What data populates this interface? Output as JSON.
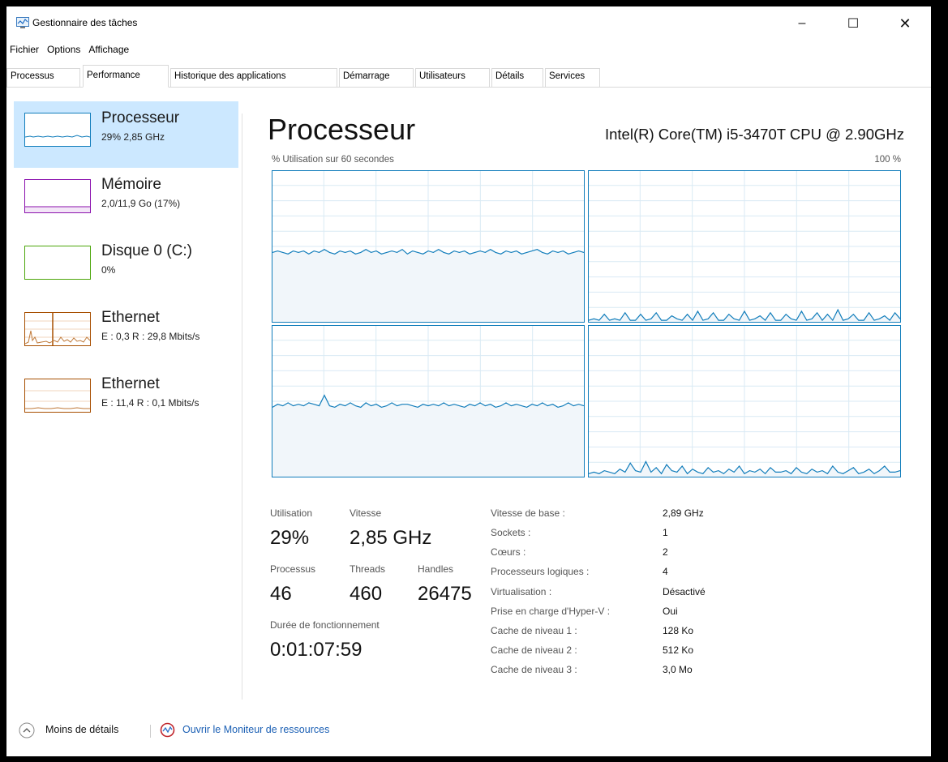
{
  "window": {
    "title": "Gestionnaire des tâches",
    "controls": {
      "minimize": "–",
      "maximize": "☐",
      "close": "✕"
    }
  },
  "menu": [
    "Fichier",
    "Options",
    "Affichage"
  ],
  "tabs": [
    "Processus",
    "Performance",
    "Historique des applications",
    "Démarrage",
    "Utilisateurs",
    "Détails",
    "Services"
  ],
  "active_tab": "Performance",
  "sidebar": {
    "items": [
      {
        "name": "Processeur",
        "sub": "29% 2,85 GHz",
        "color": "#117dbb",
        "selected": true
      },
      {
        "name": "Mémoire",
        "sub": "2,0/11,9 Go (17%)",
        "color": "#8b12ae",
        "selected": false
      },
      {
        "name": "Disque 0 (C:)",
        "sub": "0%",
        "color": "#4da60c",
        "selected": false
      },
      {
        "name": "Ethernet",
        "sub": "E : 0,3 R : 29,8 Mbits/s",
        "color": "#a74f01",
        "selected": false
      },
      {
        "name": "Ethernet",
        "sub": "E : 11,4 R : 0,1 Mbits/s",
        "color": "#a74f01",
        "selected": false
      }
    ]
  },
  "main": {
    "title": "Processeur",
    "cpu_model": "Intel(R) Core(TM) i5-3470T CPU @ 2.90GHz",
    "graph_caption": "% Utilisation sur 60 secondes",
    "graph_max": "100 %",
    "graph_color": "#117dbb",
    "graph_fill": "#f1f6fa",
    "grid_color": "#d9eaf4"
  },
  "stats": {
    "utilisation_label": "Utilisation",
    "utilisation": "29%",
    "vitesse_label": "Vitesse",
    "vitesse": "2,85 GHz",
    "processus_label": "Processus",
    "processus": "46",
    "threads_label": "Threads",
    "threads": "460",
    "handles_label": "Handles",
    "handles": "26475",
    "uptime_label": "Durée de fonctionnement",
    "uptime": "0:01:07:59"
  },
  "specs": [
    {
      "label": "Vitesse de base :",
      "value": "2,89 GHz"
    },
    {
      "label": "Sockets :",
      "value": "1"
    },
    {
      "label": "Cœurs :",
      "value": "2"
    },
    {
      "label": "Processeurs logiques :",
      "value": "4"
    },
    {
      "label": "Virtualisation :",
      "value": "Désactivé"
    },
    {
      "label": "Prise en charge d'Hyper-V :",
      "value": "Oui"
    },
    {
      "label": "Cache de niveau 1 :",
      "value": "128 Ko"
    },
    {
      "label": "Cache de niveau 2 :",
      "value": "512 Ko"
    },
    {
      "label": "Cache de niveau 3 :",
      "value": "3,0 Mo"
    }
  ],
  "footer": {
    "less_details": "Moins de détails",
    "resource_monitor": "Ouvrir le Moniteur de ressources"
  },
  "chart_data": [
    {
      "type": "area",
      "name": "core-0",
      "ylim": [
        0,
        100
      ],
      "values": [
        46,
        47,
        46,
        45,
        47,
        46,
        47,
        45,
        47,
        46,
        48,
        46,
        45,
        47,
        46,
        47,
        45,
        46,
        48,
        46,
        47,
        45,
        46,
        47,
        46,
        48,
        45,
        47,
        46,
        45,
        47,
        46,
        48,
        46,
        45,
        47,
        46,
        47,
        45,
        46,
        47,
        46,
        48,
        46,
        45,
        47,
        46,
        47,
        45,
        46,
        47,
        48,
        46,
        45,
        47,
        46,
        47,
        45,
        46,
        47,
        46
      ]
    },
    {
      "type": "area",
      "name": "core-1",
      "ylim": [
        0,
        100
      ],
      "values": [
        1,
        2,
        1,
        5,
        1,
        2,
        1,
        6,
        1,
        1,
        5,
        1,
        2,
        6,
        1,
        1,
        4,
        2,
        1,
        5,
        1,
        7,
        1,
        2,
        6,
        1,
        1,
        5,
        2,
        1,
        7,
        1,
        2,
        4,
        1,
        6,
        1,
        1,
        5,
        2,
        1,
        7,
        1,
        2,
        6,
        1,
        5,
        1,
        8,
        1,
        2,
        5,
        1,
        1,
        6,
        1,
        2,
        4,
        1,
        6,
        2
      ]
    },
    {
      "type": "area",
      "name": "core-2",
      "ylim": [
        0,
        100
      ],
      "values": [
        46,
        48,
        47,
        49,
        47,
        48,
        47,
        49,
        48,
        47,
        54,
        47,
        46,
        48,
        47,
        49,
        47,
        46,
        49,
        47,
        48,
        46,
        47,
        49,
        47,
        48,
        48,
        47,
        46,
        48,
        47,
        48,
        47,
        49,
        47,
        48,
        47,
        46,
        48,
        47,
        49,
        47,
        48,
        46,
        47,
        49,
        47,
        48,
        47,
        46,
        48,
        47,
        49,
        47,
        48,
        46,
        47,
        49,
        47,
        48,
        47
      ]
    },
    {
      "type": "area",
      "name": "core-3",
      "ylim": [
        0,
        100
      ],
      "values": [
        2,
        3,
        2,
        4,
        3,
        2,
        5,
        3,
        9,
        4,
        3,
        10,
        3,
        6,
        2,
        8,
        4,
        3,
        7,
        2,
        5,
        3,
        2,
        6,
        3,
        4,
        2,
        5,
        3,
        7,
        2,
        4,
        3,
        5,
        2,
        6,
        3,
        3,
        4,
        2,
        6,
        3,
        2,
        5,
        3,
        4,
        2,
        7,
        3,
        2,
        4,
        6,
        2,
        3,
        5,
        2,
        4,
        7,
        3,
        3,
        4
      ]
    }
  ]
}
